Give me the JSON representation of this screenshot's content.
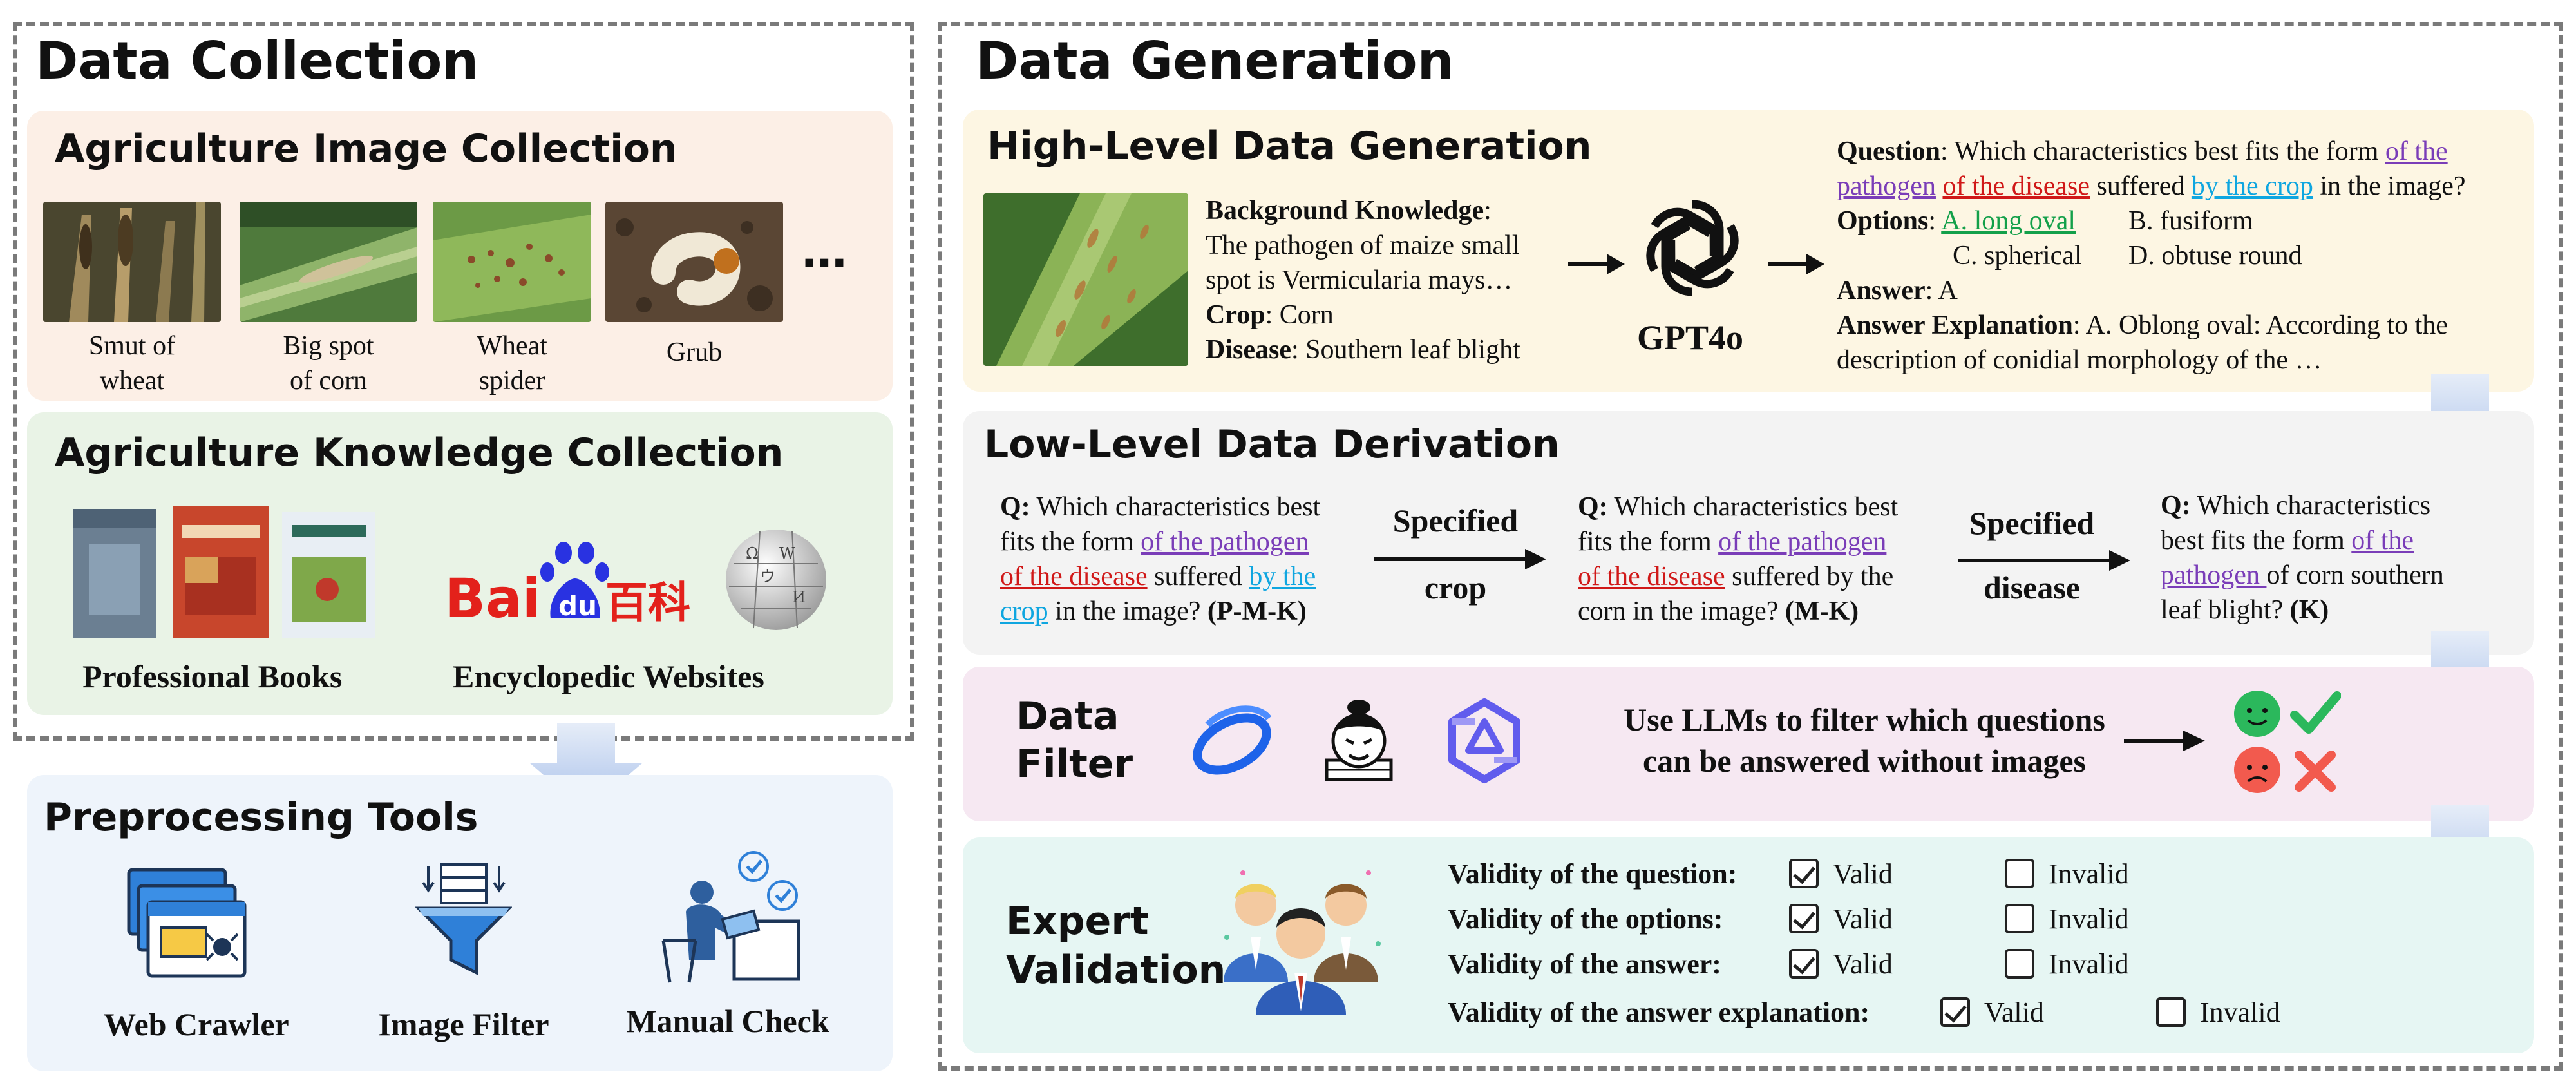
{
  "data_collection": {
    "title": "Data Collection",
    "image_collection": {
      "title": "Agriculture Image Collection",
      "images": [
        {
          "caption_line1": "Smut of",
          "caption_line2": "wheat"
        },
        {
          "caption_line1": "Big spot",
          "caption_line2": "of corn"
        },
        {
          "caption_line1": "Wheat",
          "caption_line2": "spider"
        },
        {
          "caption_line1": "Grub",
          "caption_line2": ""
        }
      ],
      "more": "…"
    },
    "knowledge_collection": {
      "title": "Agriculture Knowledge Collection",
      "baidu_logo": "Bai du 百科",
      "sources": [
        "Professional Books",
        "Encyclopedic Websites"
      ]
    }
  },
  "preprocessing": {
    "title": "Preprocessing Tools",
    "tools": [
      "Web Crawler",
      "Image Filter",
      "Manual Check"
    ]
  },
  "data_generation": {
    "title": "Data Generation",
    "high_level": {
      "title": "High-Level Data Generation",
      "background_label": "Background Knowledge",
      "background_text_1": "The pathogen of maize small",
      "background_text_2": "spot is Vermicularia mays…",
      "crop_label": "Crop",
      "crop_value": "Corn",
      "disease_label": "Disease",
      "disease_value": "Southern leaf blight",
      "model_name": "GPT4o",
      "question_label": "Question",
      "question_a": "Which characteristics best fits the form ",
      "question_pathogen": "of the pathogen",
      "question_disease": "of the disease",
      "question_b": " suffered ",
      "question_crop": "by the crop",
      "question_c": " in the image?",
      "options_label": "Options",
      "option_a": "A. long oval",
      "option_b": "B. fusiform",
      "option_c": "C. spherical",
      "option_d": "D. obtuse round",
      "answer_label": "Answer",
      "answer_value": "A",
      "explanation_label": "Answer Explanation",
      "explanation_1": "A. Oblong oval: According to the",
      "explanation_2": "description of conidial morphology of the …"
    },
    "low_level": {
      "title": "Low-Level Data Derivation",
      "q_label": "Q:",
      "q1_a": "Which characteristics best",
      "q1_b": "fits the form ",
      "q1_pathogen": "of the pathogen",
      "q1_disease": "of the disease",
      "q1_c": " suffered ",
      "q1_crop_1": "by the",
      "q1_crop_2": "crop",
      "q1_d": " in the image? ",
      "q1_tag": "(P-M-K)",
      "step1_line1": "Specified",
      "step1_line2": "crop",
      "q2_pathogen": "of the pathogen",
      "q2_disease": "of the disease",
      "q2_c": " suffered by the",
      "q2_d": "corn in the image? ",
      "q2_tag": "(M-K)",
      "step2_line1": "Specified",
      "step2_line2": "disease",
      "q3_a": "Which characteristics",
      "q3_b": "best fits the form ",
      "q3_of_the": "of the",
      "q3_pathogen": "pathogen ",
      "q3_c": "of corn southern",
      "q3_d": "leaf blight? ",
      "q3_tag": "(K)"
    },
    "data_filter": {
      "title_line1": "Data",
      "title_line2": "Filter",
      "text_line1": "Use LLMs to filter which questions",
      "text_line2": "can be answered without images"
    },
    "expert_validation": {
      "title_line1": "Expert",
      "title_line2": "Validation",
      "rows": [
        {
          "label": "Validity of the question:",
          "valid": "Valid",
          "invalid": "Invalid",
          "checked": "valid"
        },
        {
          "label": "Validity of the options:",
          "valid": "Valid",
          "invalid": "Invalid",
          "checked": "valid"
        },
        {
          "label": "Validity of the answer:",
          "valid": "Valid",
          "invalid": "Invalid",
          "checked": "valid"
        },
        {
          "label": "Validity of the answer explanation:",
          "valid": "Valid",
          "invalid": "Invalid",
          "checked": "valid"
        }
      ]
    }
  },
  "colors": {
    "image_panel": "#fcefe6",
    "knowledge_panel": "#e9f3e6",
    "preprocess_panel": "#eef4fb",
    "high_level_panel": "#fdf6e3",
    "low_level_panel": "#f3f3f3",
    "filter_panel": "#f6e8f2",
    "validation_panel": "#e6f6f3",
    "arrow": "#b8cdee",
    "dashed_border": "#7a7a7a"
  }
}
